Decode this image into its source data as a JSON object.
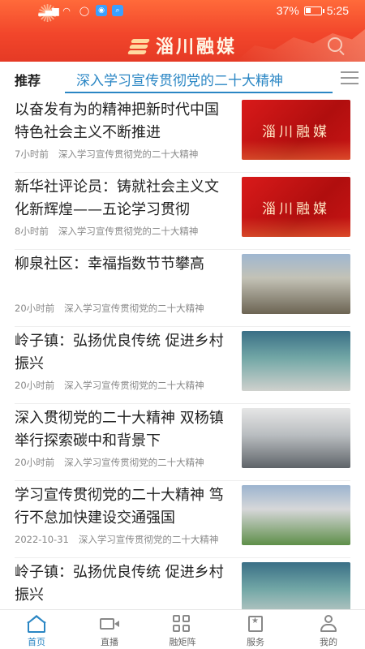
{
  "status_bar": {
    "battery": "37%",
    "battery_level": 0.37,
    "time": "5:25"
  },
  "header": {
    "app_name": "淄川融媒"
  },
  "tabs": {
    "recommend": "推荐",
    "active": "深入学习宣传贯彻党的二十大精神"
  },
  "news": [
    {
      "title": "以奋发有为的精神把新时代中国特色社会主义不断推进",
      "time": "7小时前",
      "channel": "深入学习宣传贯彻党的二十大精神",
      "thumb": "red",
      "thumb_text": "淄川融媒"
    },
    {
      "title": "新华社评论员：铸就社会主义文化新辉煌——五论学习贯彻",
      "time": "8小时前",
      "channel": "深入学习宣传贯彻党的二十大精神",
      "thumb": "red",
      "thumb_text": "淄川融媒"
    },
    {
      "title": "柳泉社区：幸福指数节节攀高",
      "time": "20小时前",
      "channel": "深入学习宣传贯彻党的二十大精神",
      "thumb": "photo1"
    },
    {
      "title": "岭子镇：弘扬优良传统 促进乡村振兴",
      "time": "20小时前",
      "channel": "深入学习宣传贯彻党的二十大精神",
      "thumb": "photo2"
    },
    {
      "title": "深入贯彻党的二十大精神 双杨镇举行探索碳中和背景下",
      "time": "20小时前",
      "channel": "深入学习宣传贯彻党的二十大精神",
      "thumb": "photo3"
    },
    {
      "title": "学习宣传贯彻党的二十大精神 笃行不怠加快建设交通强国",
      "time": "2022-10-31",
      "channel": "深入学习宣传贯彻党的二十大精神",
      "thumb": "photo4"
    },
    {
      "title": "岭子镇：弘扬优良传统 促进乡村振兴",
      "time": "",
      "channel": "",
      "thumb": "photo2"
    }
  ],
  "bottom_nav": [
    {
      "label": "首页",
      "icon": "home-icon",
      "active": true
    },
    {
      "label": "直播",
      "icon": "video-camera-icon",
      "active": false
    },
    {
      "label": "融矩阵",
      "icon": "grid-icon",
      "active": false
    },
    {
      "label": "服务",
      "icon": "service-star-icon",
      "active": false
    },
    {
      "label": "我的",
      "icon": "user-icon",
      "active": false
    }
  ],
  "colors": {
    "header_red": "#f2462b",
    "accent_blue": "#2a86c4"
  }
}
